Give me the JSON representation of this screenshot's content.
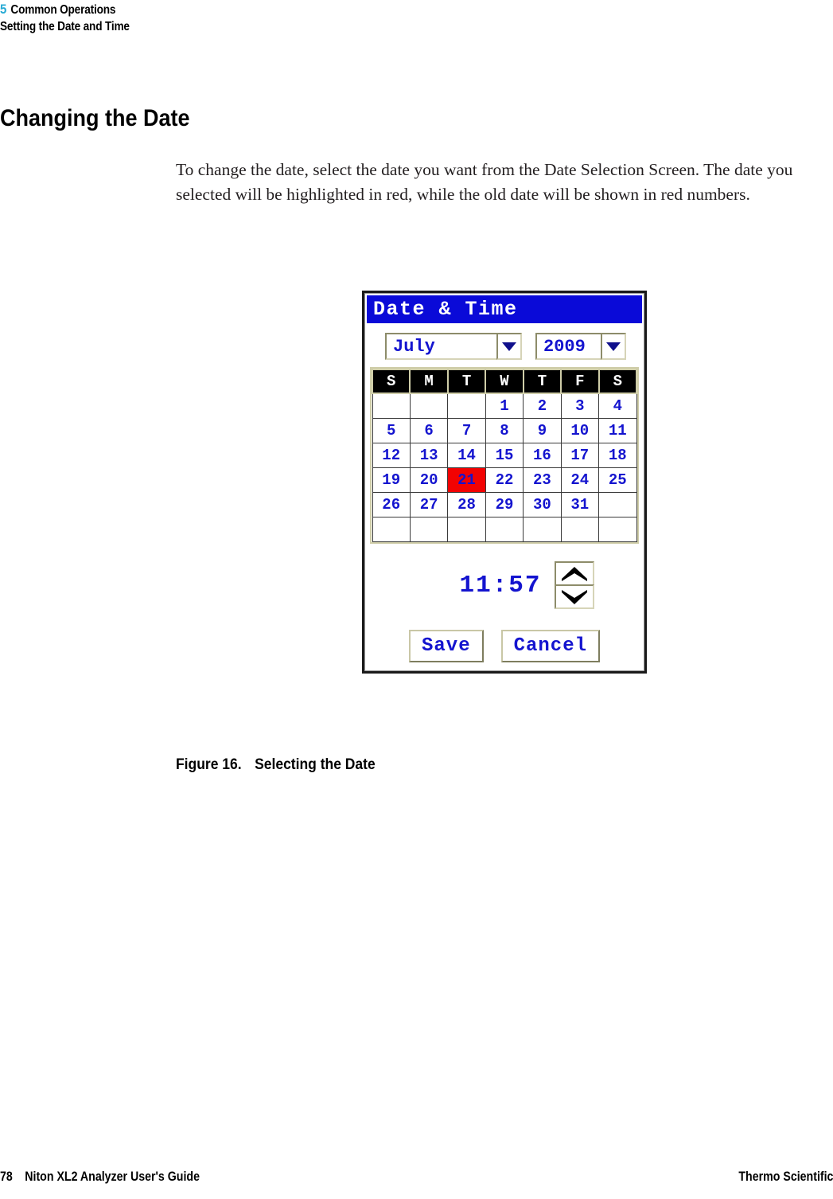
{
  "header": {
    "chapter_number": "5",
    "chapter_title": "Common Operations",
    "section_title": "Setting the Date and Time",
    "chapter_number_color": "#27AAD4"
  },
  "section": {
    "heading": "Changing the Date",
    "paragraph": "To change the date, select the date you want from the Date Selection Screen. The date you selected will be highlighted in red, while the old date will be shown in red numbers."
  },
  "figure": {
    "label": "Figure 16.",
    "title": "Selecting the Date"
  },
  "device_screen": {
    "titlebar": "Date & Time",
    "titlebar_bg": "#0A0AD8",
    "titlebar_color": "#FFFFFF",
    "month_dropdown": {
      "value": "July",
      "icon": "chevron-down-icon"
    },
    "year_dropdown": {
      "value": "2009",
      "icon": "chevron-down-icon"
    },
    "calendar": {
      "weekday_headers": [
        "S",
        "M",
        "T",
        "W",
        "T",
        "F",
        "S"
      ],
      "selected_date": "21",
      "old_date": "20",
      "selected_bg": "#F20202",
      "old_date_color": "#EE1111",
      "date_color": "#1414CF",
      "rows": [
        [
          {
            "label": "",
            "state": "empty"
          },
          {
            "label": "",
            "state": "empty"
          },
          {
            "label": "",
            "state": "empty"
          },
          {
            "label": "1",
            "state": "normal"
          },
          {
            "label": "2",
            "state": "normal"
          },
          {
            "label": "3",
            "state": "normal"
          },
          {
            "label": "4",
            "state": "normal"
          }
        ],
        [
          {
            "label": "5",
            "state": "normal"
          },
          {
            "label": "6",
            "state": "normal"
          },
          {
            "label": "7",
            "state": "normal"
          },
          {
            "label": "8",
            "state": "normal"
          },
          {
            "label": "9",
            "state": "normal"
          },
          {
            "label": "10",
            "state": "normal"
          },
          {
            "label": "11",
            "state": "normal"
          }
        ],
        [
          {
            "label": "12",
            "state": "normal"
          },
          {
            "label": "13",
            "state": "normal"
          },
          {
            "label": "14",
            "state": "normal"
          },
          {
            "label": "15",
            "state": "normal"
          },
          {
            "label": "16",
            "state": "normal"
          },
          {
            "label": "17",
            "state": "normal"
          },
          {
            "label": "18",
            "state": "normal"
          }
        ],
        [
          {
            "label": "19",
            "state": "normal"
          },
          {
            "label": "20",
            "state": "old"
          },
          {
            "label": "21",
            "state": "selected"
          },
          {
            "label": "22",
            "state": "normal"
          },
          {
            "label": "23",
            "state": "normal"
          },
          {
            "label": "24",
            "state": "normal"
          },
          {
            "label": "25",
            "state": "normal"
          }
        ],
        [
          {
            "label": "26",
            "state": "normal"
          },
          {
            "label": "27",
            "state": "normal"
          },
          {
            "label": "28",
            "state": "normal"
          },
          {
            "label": "29",
            "state": "normal"
          },
          {
            "label": "30",
            "state": "normal"
          },
          {
            "label": "31",
            "state": "normal"
          },
          {
            "label": "",
            "state": "empty"
          }
        ],
        [
          {
            "label": "",
            "state": "empty"
          },
          {
            "label": "",
            "state": "empty"
          },
          {
            "label": "",
            "state": "empty"
          },
          {
            "label": "",
            "state": "empty"
          },
          {
            "label": "",
            "state": "empty"
          },
          {
            "label": "",
            "state": "empty"
          },
          {
            "label": "",
            "state": "empty"
          }
        ]
      ]
    },
    "time": {
      "value": "11:57",
      "up_icon": "chevron-up-icon",
      "down_icon": "chevron-down-icon"
    },
    "buttons": {
      "save": "Save",
      "cancel": "Cancel"
    }
  },
  "footer": {
    "page_number": "78",
    "guide_title": "Niton XL2 Analyzer User's Guide",
    "brand": "Thermo Scientific"
  }
}
